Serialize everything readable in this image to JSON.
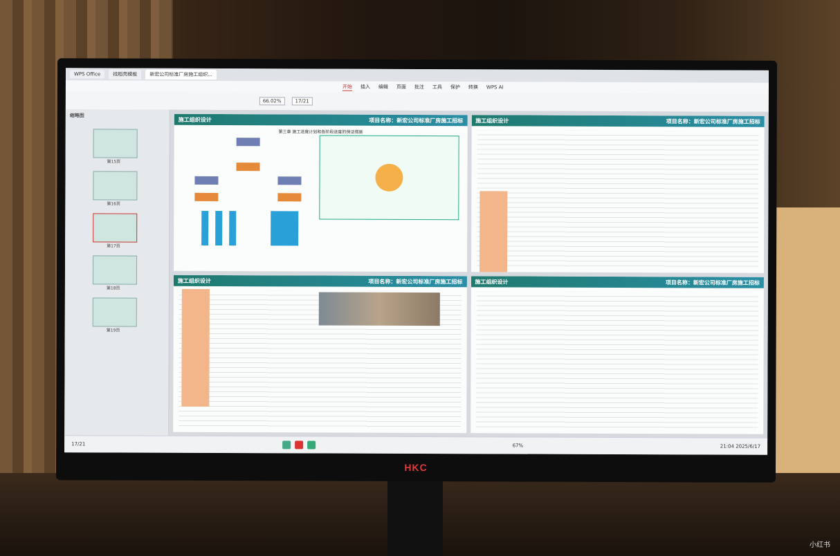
{
  "monitor": {
    "brand": "HKC"
  },
  "app": {
    "tabs": [
      "WPS Office",
      "找稻壳模板",
      "新宏公司标准厂房施工组织..."
    ],
    "ribbon_tabs": [
      "开始",
      "插入",
      "编辑",
      "页面",
      "批注",
      "工具",
      "保护",
      "转换",
      "WPS AI"
    ],
    "zoom": "66.02%",
    "page_indicator": "17/21"
  },
  "sidebar": {
    "title": "缩略图",
    "thumbnails": [
      "第15页",
      "第16页",
      "第17页",
      "第18页",
      "第19页"
    ]
  },
  "pages": [
    {
      "header_left": "施工组织设计",
      "header_right": "项目名称：新宏公司标准厂房施工招标",
      "subtitle": "第三章 施工进度计划和各阶段进度的保证措施"
    },
    {
      "header_left": "施工组织设计",
      "header_right": "项目名称：新宏公司标准厂房施工招标"
    },
    {
      "header_left": "施工组织设计",
      "header_right": "项目名称：新宏公司标准厂房施工招标"
    },
    {
      "header_left": "施工组织设计",
      "header_right": "项目名称：新宏公司标准厂房施工招标"
    }
  ],
  "statusbar": {
    "page": "17/21",
    "zoom": "67%",
    "time": "21:04",
    "date": "2025/6/17"
  },
  "watermark": "小红书"
}
